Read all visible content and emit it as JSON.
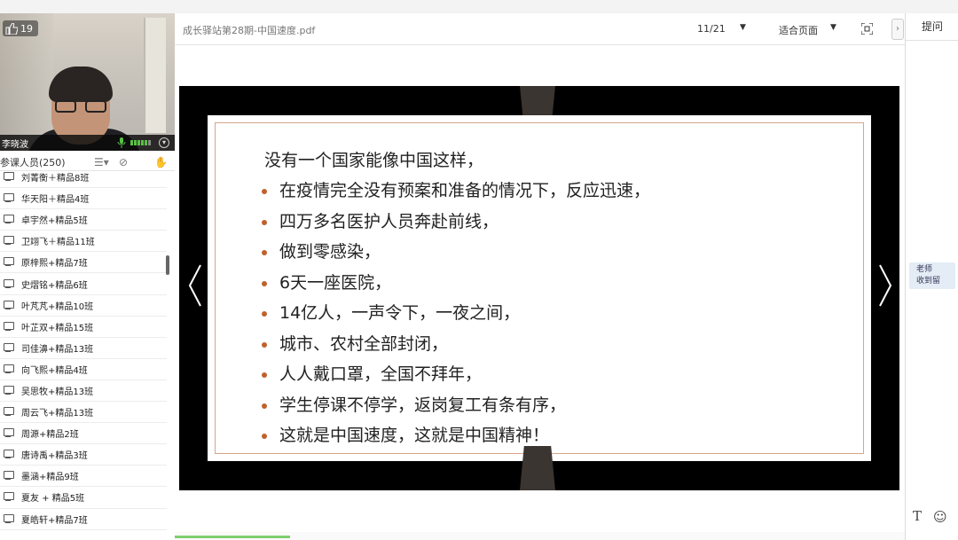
{
  "video": {
    "like_count": "19",
    "presenter_name": "李晓波"
  },
  "participants": {
    "title": "参课人员(250)",
    "items": [
      "刘菁衡＋精品8班",
      "华天阳＋精品4班",
      "卓宇然+精品5班",
      "卫翊飞＋精品11班",
      "原梓熙+精品7班",
      "史熠铭+精品6班",
      "叶芃芃+精品10班",
      "叶芷双+精品15班",
      "司佳濞+精品13班",
      "向飞熙+精品4班",
      "吴思牧+精品13班",
      "周云飞+精品13班",
      "周源+精品2班",
      "唐诗禹+精品3班",
      "墨涵+精品9班",
      "夏友 + 精品5班",
      "夏皓轩+精品7班"
    ]
  },
  "toolbar": {
    "doc_title": "成长驿站第28期-中国速度.pdf",
    "page_indicator": "11/21",
    "fit_mode": "适合页面",
    "collapse_glyph": "›"
  },
  "right_panel": {
    "qa_tab": "提问",
    "teacher_note_line1": "老师",
    "teacher_note_line2": "收到留",
    "text_tool": "T",
    "emoji_tool": "☺"
  },
  "slide": {
    "heading": "没有一个国家能像中国这样，",
    "bullets": [
      "在疫情完全没有预案和准备的情况下，反应迅速，",
      "四万多名医护人员奔赴前线，",
      "做到零感染，",
      "6天一座医院，",
      "14亿人，一声令下，一夜之间，",
      "城市、农村全部封闭，",
      "人人戴口罩，全国不拜年，",
      "学生停课不停学，返岗复工有条有序，",
      "这就是中国速度，这就是中国精神！"
    ],
    "accent_color": "#c0612c"
  }
}
